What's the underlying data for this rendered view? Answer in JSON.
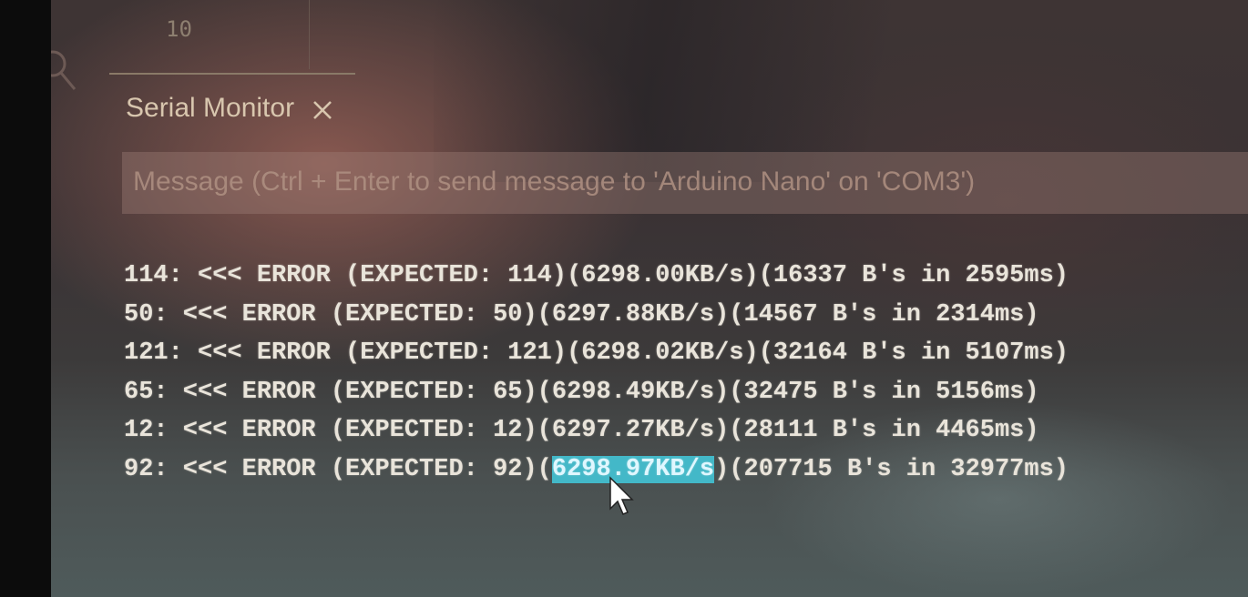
{
  "editor": {
    "line_number": "10"
  },
  "serial_monitor": {
    "tab_label": "Serial Monitor",
    "close_icon": "close-icon",
    "message_placeholder": "Message (Ctrl + Enter to send message to 'Arduino Nano' on 'COM3')",
    "output": [
      {
        "text": "114: <<< ERROR (EXPECTED: 114)(6298.00KB/s)(16337 B's in 2595ms)"
      },
      {
        "text": "50: <<< ERROR (EXPECTED: 50)(6297.88KB/s)(14567 B's in 2314ms)"
      },
      {
        "text": "121: <<< ERROR (EXPECTED: 121)(6298.02KB/s)(32164 B's in 5107ms)"
      },
      {
        "text": "65: <<< ERROR (EXPECTED: 65)(6298.49KB/s)(32475 B's in 5156ms)"
      },
      {
        "text": "12: <<< ERROR (EXPECTED: 12)(6297.27KB/s)(28111 B's in 4465ms)"
      },
      {
        "prefix": "92: <<< ERROR (EXPECTED: 92)(",
        "selected": "6298.97KB/s",
        "suffix": ")(207715 B's in 32977ms)"
      }
    ]
  },
  "colors": {
    "text": "#e9e4da",
    "selection": "#43b8c8",
    "tab_text": "#d8c6ae"
  },
  "icons": [
    "search-icon",
    "close-icon",
    "mouse-cursor-icon"
  ]
}
